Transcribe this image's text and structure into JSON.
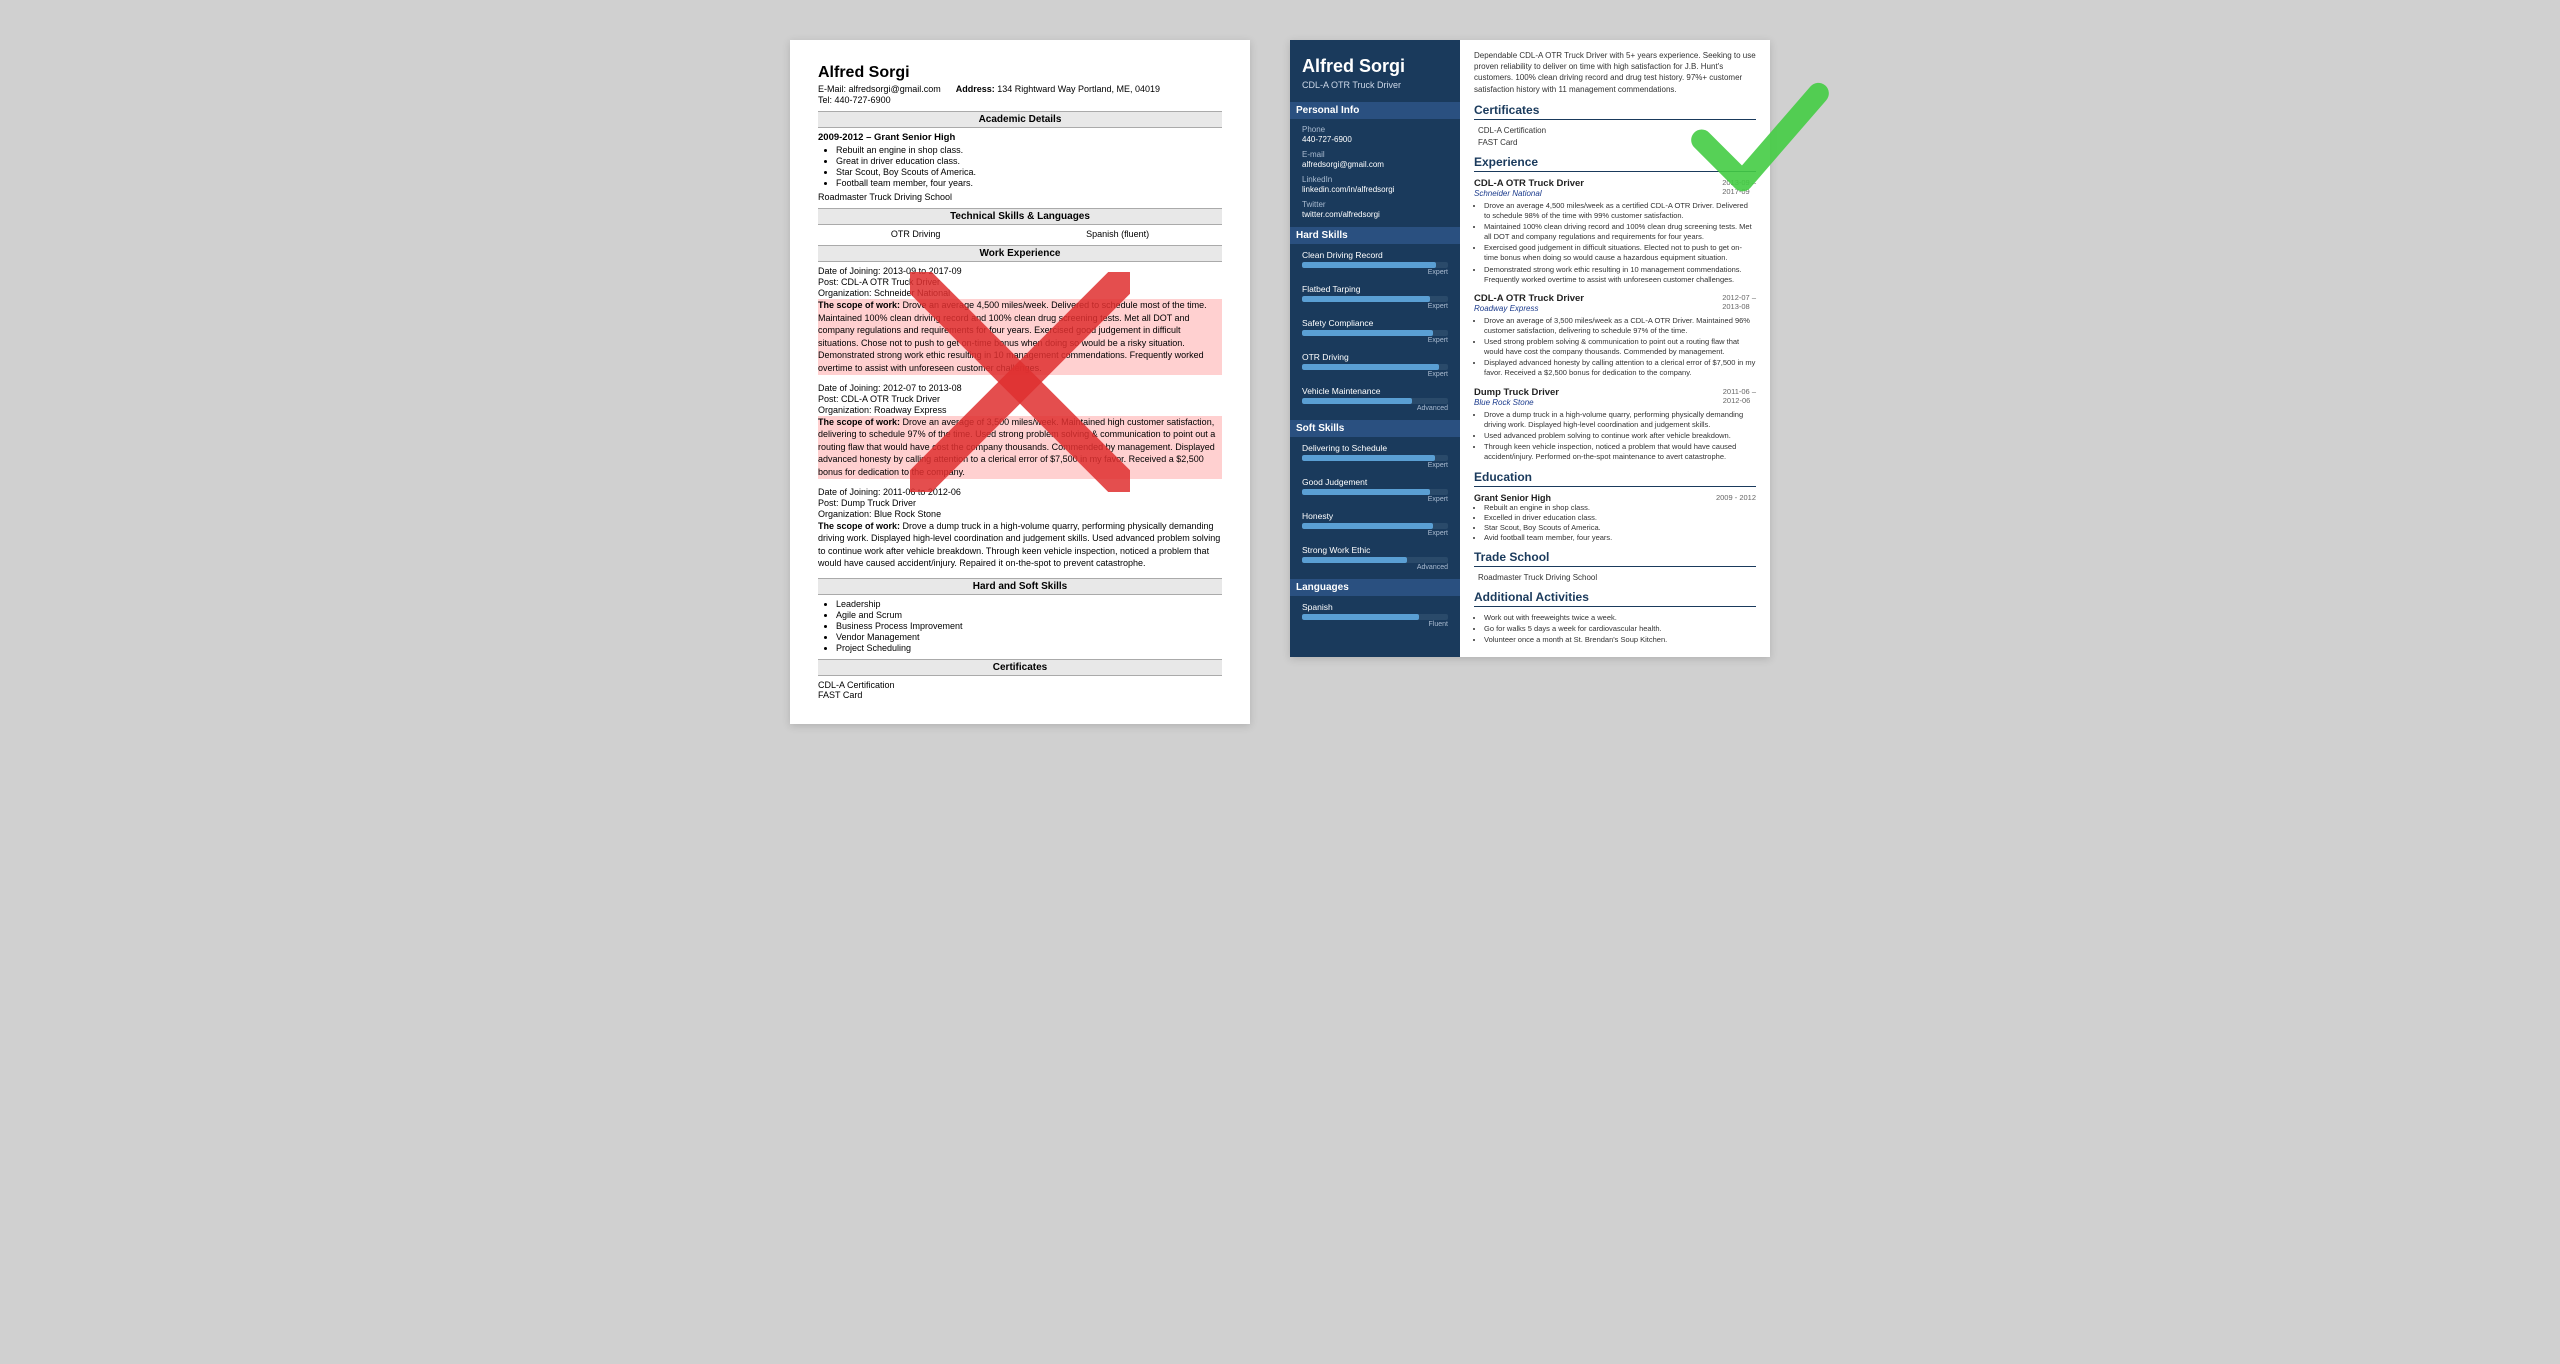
{
  "left_resume": {
    "name": "Alfred Sorgi",
    "email_label": "E-Mail:",
    "email": "alfredsorgi@gmail.com",
    "address_label": "Address:",
    "address": "134 Rightward Way Portland, ME, 04019",
    "tel_label": "Tel:",
    "tel": "440-727-6900",
    "sections": {
      "academic": {
        "title": "Academic Details",
        "school": "2009-2012 – Grant Senior High",
        "bullets": [
          "Rebuilt an engine in shop class.",
          "Great in driver education class.",
          "Star Scout, Boy Scouts of America.",
          "Football team member, four years."
        ],
        "driving_school": "Roadmaster Truck Driving School"
      },
      "technical_skills": {
        "title": "Technical Skills & Languages",
        "items": [
          "OTR Driving",
          "Spanish (fluent)"
        ]
      },
      "work_experience": {
        "title": "Work Experience",
        "jobs": [
          {
            "date": "Date of Joining: 2013-09 to 2017-09",
            "post": "Post: CDL-A OTR Truck Driver",
            "org": "Organization: Schneider National",
            "scope_label": "The scope of work:",
            "scope": "Drove an average 4,500 miles/week. Delivered to schedule most of the time. Maintained 100% clean driving record and 100% clean drug screening tests. Met all DOT and company regulations and requirements for four years. Exercised good judgement in difficult situations. Chose not to push to get on-time bonus when doing so would be a risky situation. Demonstrated strong work ethic resulting in 10 management commendations. Frequently worked overtime to assist with unforeseen customer challenges."
          },
          {
            "date": "Date of Joining: 2012-07 to 2013-08",
            "post": "Post: CDL-A OTR Truck Driver",
            "org": "Organization: Roadway Express",
            "scope_label": "The scope of work:",
            "scope": "Drove an average of 3,500 miles/week. Maintained high customer satisfaction, delivering to schedule 97% of the time. Used strong problem solving & communication to point out a routing flaw that would have cost the company thousands. Commended by management. Displayed advanced honesty by calling attention to a clerical error of $7,500 in my favor. Received a $2,500 bonus for dedication to the company."
          },
          {
            "date": "Date of Joining: 2011-06 to 2012-06",
            "post": "Post: Dump Truck Driver",
            "org": "Organization: Blue Rock Stone",
            "scope_label": "The scope of work:",
            "scope": "Drove a dump truck in a high-volume quarry, performing physically demanding driving work. Displayed high-level coordination and judgement skills. Used advanced problem solving to continue work after vehicle breakdown. Through keen vehicle inspection, noticed a problem that would have caused accident/injury. Repaired it on-the-spot to prevent catastrophe."
          }
        ]
      },
      "hard_soft_skills": {
        "title": "Hard and Soft Skills",
        "items": [
          "Leadership",
          "Agile and Scrum",
          "Business Process Improvement",
          "Vendor Management",
          "Project Scheduling"
        ]
      },
      "certificates": {
        "title": "Certificates",
        "items": [
          "CDL-A Certification",
          "FAST Card"
        ]
      }
    }
  },
  "right_resume": {
    "name": "Alfred Sorgi",
    "title": "CDL-A OTR Truck Driver",
    "summary": "Dependable CDL-A OTR Truck Driver with 5+ years experience. Seeking to use proven reliability to deliver on time with high satisfaction for J.B. Hunt's customers. 100% clean driving record and drug test history. 97%+ customer satisfaction history with 11 management commendations.",
    "sidebar": {
      "personal_info_title": "Personal Info",
      "phone_label": "Phone",
      "phone": "440-727-6900",
      "email_label": "E-mail",
      "email": "alfredsorgi@gmail.com",
      "linkedin_label": "LinkedIn",
      "linkedin": "linkedin.com/in/alfredsorgi",
      "twitter_label": "Twitter",
      "twitter": "twitter.com/alfredsorgi",
      "hard_skills_title": "Hard Skills",
      "hard_skills": [
        {
          "name": "Clean Driving Record",
          "level": "Expert",
          "pct": 92
        },
        {
          "name": "Flatbed Tarping",
          "level": "Expert",
          "pct": 88
        },
        {
          "name": "Safety Compliance",
          "level": "Expert",
          "pct": 90
        },
        {
          "name": "OTR Driving",
          "level": "Expert",
          "pct": 94
        },
        {
          "name": "Vehicle Maintenance",
          "level": "Advanced",
          "pct": 75
        }
      ],
      "soft_skills_title": "Soft Skills",
      "soft_skills": [
        {
          "name": "Delivering to Schedule",
          "level": "Expert",
          "pct": 91
        },
        {
          "name": "Good Judgement",
          "level": "Expert",
          "pct": 88
        },
        {
          "name": "Honesty",
          "level": "Expert",
          "pct": 90
        },
        {
          "name": "Strong Work Ethic",
          "level": "Advanced",
          "pct": 72
        }
      ],
      "languages_title": "Languages",
      "languages": [
        {
          "name": "Spanish",
          "level": "Fluent",
          "pct": 80
        }
      ]
    },
    "main": {
      "certificates_title": "Certificates",
      "certificates": [
        "CDL-A Certification",
        "FAST Card"
      ],
      "experience_title": "Experience",
      "jobs": [
        {
          "date_start": "2013-09",
          "date_end": "2017-09",
          "title": "CDL-A OTR Truck Driver",
          "company": "Schneider National",
          "bullets": [
            "Drove an average 4,500 miles/week as a certified CDL-A OTR Driver. Delivered to schedule 98% of the time with 99% customer satisfaction.",
            "Maintained 100% clean driving record and 100% clean drug screening tests. Met all DOT and company regulations and requirements for four years.",
            "Exercised good judgement in difficult situations. Elected not to push to get on-time bonus when doing so would cause a hazardous equipment situation.",
            "Demonstrated strong work ethic resulting in 10 management commendations. Frequently worked overtime to assist with unforeseen customer challenges."
          ]
        },
        {
          "date_start": "2012-07",
          "date_end": "2013-08",
          "title": "CDL-A OTR Truck Driver",
          "company": "Roadway Express",
          "bullets": [
            "Drove an average of 3,500 miles/week as a CDL-A OTR Driver. Maintained 96% customer satisfaction, delivering to schedule 97% of the time.",
            "Used strong problem solving & communication to point out a routing flaw that would have cost the company thousands. Commended by management.",
            "Displayed advanced honesty by calling attention to a clerical error of $7,500 in my favor. Received a $2,500 bonus for dedication to the company."
          ]
        },
        {
          "date_start": "2011-06",
          "date_end": "2012-06",
          "title": "Dump Truck Driver",
          "company": "Blue Rock Stone",
          "bullets": [
            "Drove a dump truck in a high-volume quarry, performing physically demanding driving work. Displayed high-level coordination and judgement skills.",
            "Used advanced problem solving to continue work after vehicle breakdown.",
            "Through keen vehicle inspection, noticed a problem that would have caused accident/injury. Performed on-the-spot maintenance to avert catastrophe."
          ]
        }
      ],
      "education_title": "Education",
      "education": [
        {
          "date_start": "2009 -",
          "date_end": "2012",
          "school": "Grant Senior High",
          "bullets": [
            "Rebuilt an engine in shop class.",
            "Excelled in driver education class.",
            "Star Scout, Boy Scouts of America.",
            "Avid football team member, four years."
          ]
        }
      ],
      "trade_school_title": "Trade School",
      "trade_school": "Roadmaster Truck Driving School",
      "activities_title": "Additional Activities",
      "activities": [
        "Work out with freeweights twice a week.",
        "Go for walks 5 days a week for cardiovascular health.",
        "Volunteer once a month at St. Brendan's Soup Kitchen."
      ]
    }
  }
}
